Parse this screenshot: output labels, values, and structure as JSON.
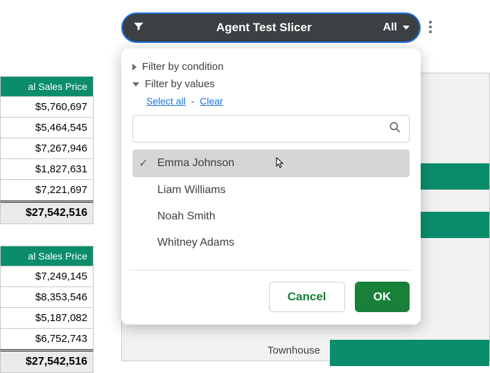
{
  "tables": {
    "header_label": "al Sales Price",
    "top": {
      "rows": [
        "$5,760,697",
        "$5,464,545",
        "$7,267,946",
        "$1,827,631",
        "$7,221,697"
      ],
      "total": "$27,542,516"
    },
    "bottom": {
      "rows": [
        "$7,249,145",
        "$8,353,546",
        "$5,187,082",
        "$6,752,743"
      ],
      "total": "$27,542,516"
    }
  },
  "chart": {
    "category_label": "Townhouse"
  },
  "slicer": {
    "title": "Agent Test Slicer",
    "scope": "All",
    "filter_by_condition": "Filter by condition",
    "filter_by_values": "Filter by values",
    "select_all": "Select all",
    "clear": "Clear",
    "search_placeholder": "",
    "values": [
      {
        "label": "Emma Johnson",
        "selected": true
      },
      {
        "label": "Liam Williams",
        "selected": false
      },
      {
        "label": "Noah Smith",
        "selected": false
      },
      {
        "label": "Whitney Adams",
        "selected": false
      }
    ],
    "cancel": "Cancel",
    "ok": "OK"
  }
}
